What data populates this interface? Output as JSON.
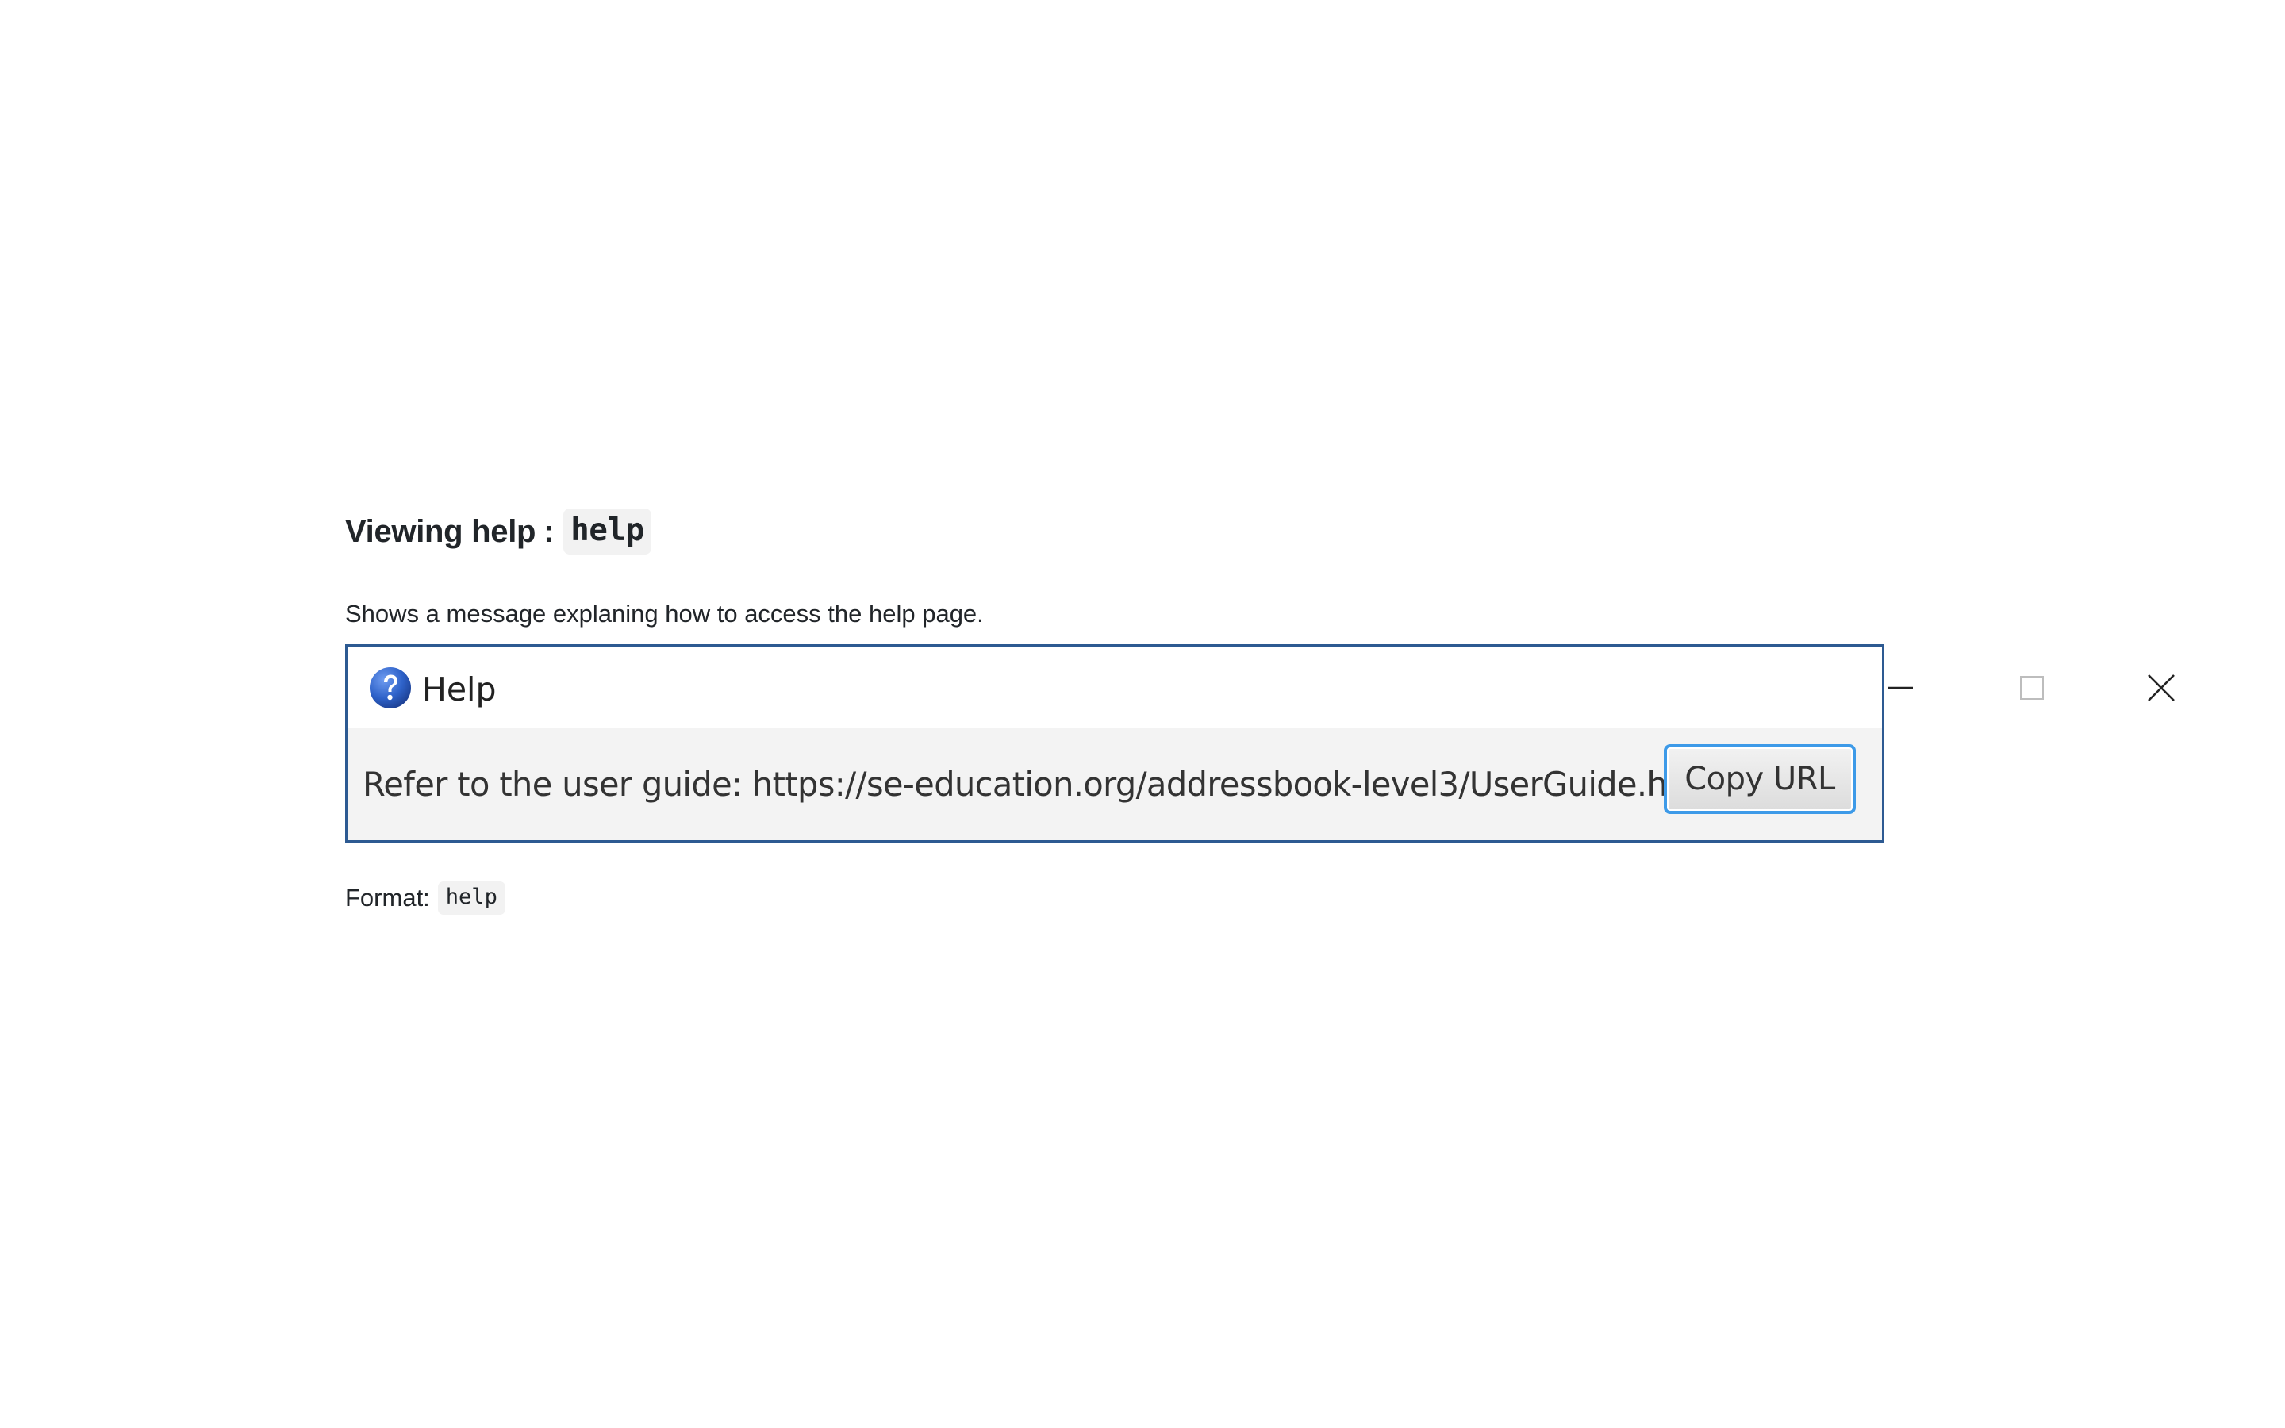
{
  "heading": {
    "text": "Viewing help",
    "separator": ":",
    "command": "help"
  },
  "description": "Shows a message explaning how to access the help page.",
  "help_window": {
    "title": "Help",
    "title_icon": "question-icon",
    "controls": {
      "minimize_icon": "minimize-icon",
      "maximize_icon": "maximize-icon",
      "close_icon": "close-icon"
    },
    "message": "Refer to the user guide: https://se-education.org/addressbook-level3/UserGuide.html",
    "copy_button_label": "Copy URL",
    "colors": {
      "border": "#2d5a92",
      "button_focus": "#3d9ae8",
      "icon_blue": "#2e62c9"
    }
  },
  "format": {
    "label": "Format:",
    "command": "help"
  }
}
